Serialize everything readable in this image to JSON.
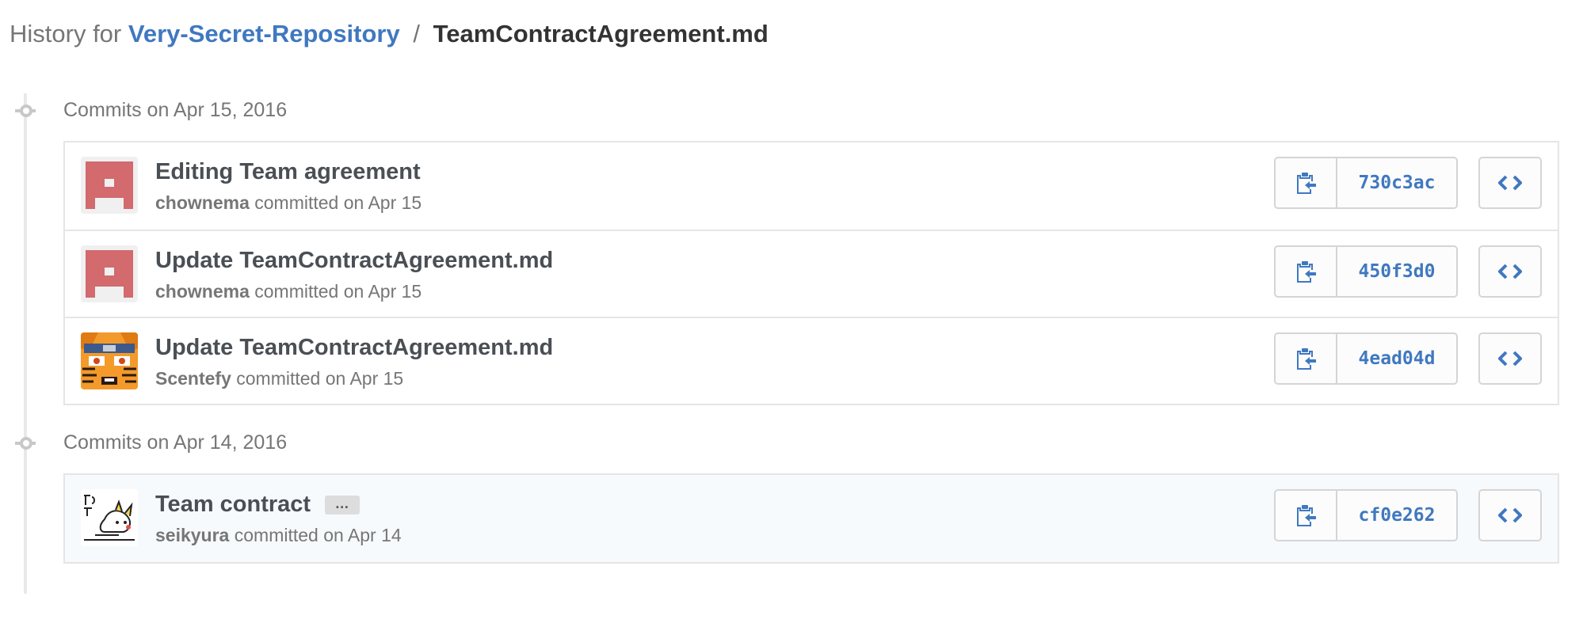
{
  "header": {
    "prefix": "History for",
    "repo": "Very-Secret-Repository",
    "separator": "/",
    "file": "TeamContractAgreement.md"
  },
  "groups": [
    {
      "title": "Commits on Apr 15, 2016",
      "commits": [
        {
          "message": "Editing Team agreement",
          "author": "chownema",
          "committed": "committed on Apr 15",
          "sha": "730c3ac",
          "avatar": "identicon-red"
        },
        {
          "message": "Update TeamContractAgreement.md",
          "author": "chownema",
          "committed": "committed on Apr 15",
          "sha": "450f3d0",
          "avatar": "identicon-red"
        },
        {
          "message": "Update TeamContractAgreement.md",
          "author": "Scentefy",
          "committed": "committed on Apr 15",
          "sha": "4ead04d",
          "avatar": "anime-avatar"
        }
      ]
    },
    {
      "title": "Commits on Apr 14, 2016",
      "commits": [
        {
          "message": "Team contract",
          "ellipsis": "…",
          "author": "seikyura",
          "committed": "committed on Apr 14",
          "sha": "cf0e262",
          "avatar": "pikachu-sketch-avatar"
        }
      ]
    }
  ],
  "icons": {
    "copy": "clipboard-copy-icon",
    "browse": "code-brackets-icon"
  },
  "colors": {
    "link": "#4078c0",
    "muted": "#767676",
    "identicon": "#d26a6e",
    "highlight_row": "#f7fafc"
  }
}
